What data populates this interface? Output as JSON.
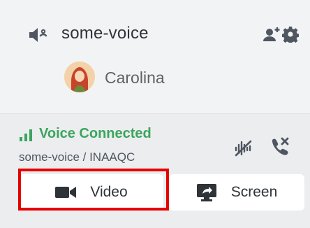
{
  "channel": {
    "name": "some-voice"
  },
  "user": {
    "name": "Carolina"
  },
  "voice": {
    "status": "Voice Connected",
    "detail": "some-voice / INAAQC",
    "status_color": "#3ba55d"
  },
  "buttons": {
    "video": "Video",
    "screen": "Screen"
  },
  "icons": [
    "speaker-settings-icon",
    "invite-icon",
    "gear-icon",
    "signal-icon",
    "noise-suppression-icon",
    "disconnect-icon",
    "camera-icon",
    "screen-share-icon"
  ],
  "colors": {
    "highlight": "#e60000",
    "panel": "#ebedef",
    "background": "#f2f3f5"
  }
}
